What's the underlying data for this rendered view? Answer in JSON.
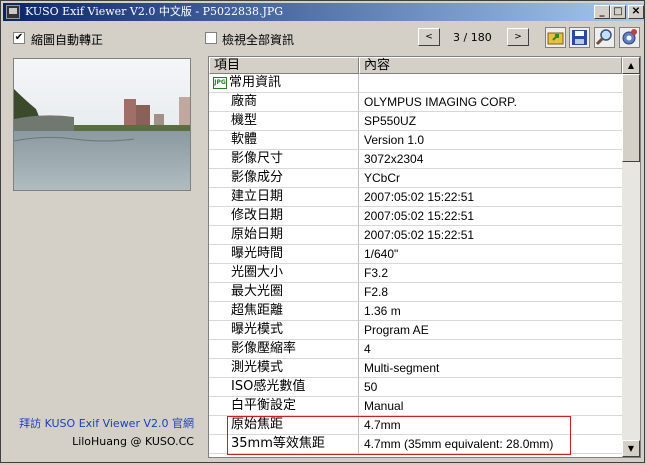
{
  "window": {
    "title": "KUSO Exif Viewer V2.0 中文版 - P5022838.JPG"
  },
  "titlebar_buttons": {
    "minimize": "_",
    "maximize": "□",
    "close": "✕"
  },
  "options": {
    "auto_rotate_label": "縮圖自動轉正",
    "auto_rotate_checked": "✔",
    "show_all_label": "檢視全部資訊"
  },
  "nav": {
    "prev": "<",
    "counter": "3 / 180",
    "next": ">"
  },
  "toolbar": {
    "icons": [
      "open-folder-icon",
      "save-icon",
      "zoom-icon",
      "settings-icon"
    ]
  },
  "table": {
    "columns": [
      "項目",
      "內容"
    ],
    "group": "常用資訊",
    "rows": [
      {
        "name": "廠商",
        "value": "OLYMPUS IMAGING CORP."
      },
      {
        "name": "機型",
        "value": "SP550UZ"
      },
      {
        "name": "軟體",
        "value": "Version 1.0"
      },
      {
        "name": "影像尺寸",
        "value": "3072x2304"
      },
      {
        "name": "影像成分",
        "value": "YCbCr"
      },
      {
        "name": "建立日期",
        "value": "2007:05:02 15:22:51"
      },
      {
        "name": "修改日期",
        "value": "2007:05:02 15:22:51"
      },
      {
        "name": "原始日期",
        "value": "2007:05:02 15:22:51"
      },
      {
        "name": "曝光時間",
        "value": "1/640\""
      },
      {
        "name": "光圈大小",
        "value": "F3.2"
      },
      {
        "name": "最大光圈",
        "value": "F2.8"
      },
      {
        "name": "超焦距離",
        "value": "1.36 m"
      },
      {
        "name": "曝光模式",
        "value": "Program AE"
      },
      {
        "name": "影像壓縮率",
        "value": "4"
      },
      {
        "name": "測光模式",
        "value": "Multi-segment"
      },
      {
        "name": "ISO感光數值",
        "value": "50"
      },
      {
        "name": "白平衡設定",
        "value": "Manual"
      },
      {
        "name": "原始焦距",
        "value": "4.7mm"
      },
      {
        "name": "35mm等效焦距",
        "value": "4.7mm (35mm equivalent: 28.0mm)"
      }
    ]
  },
  "footer": {
    "link": "拜訪 KUSO Exif Viewer V2.0 官網",
    "credit": "LiloHuang @ KUSO.CC"
  },
  "colors": {
    "link": "#1a3fc0",
    "highlight": "#cc2020",
    "title_start": "#0a246a",
    "title_end": "#a6caf0"
  }
}
